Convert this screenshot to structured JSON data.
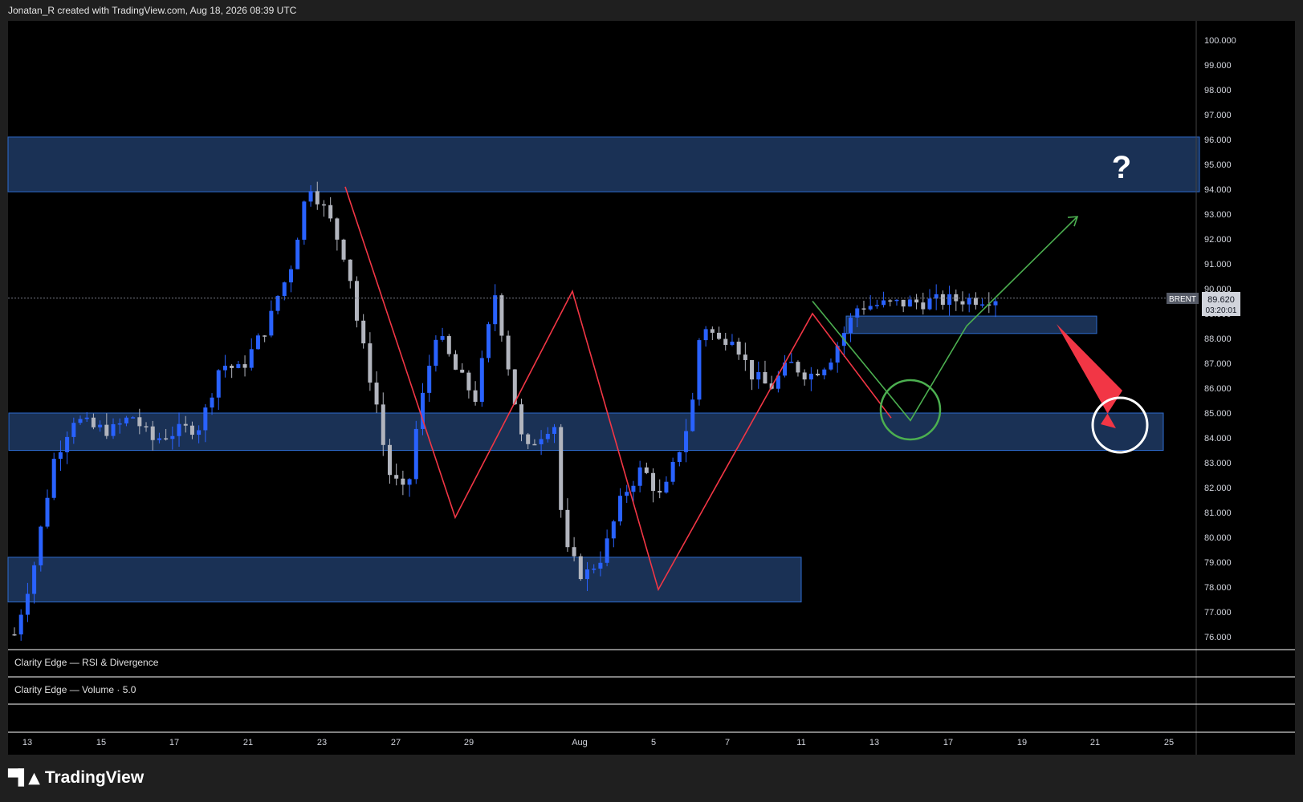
{
  "header": {
    "caption": "Jonatan_R created with TradingView.com, Aug 18, 2026 08:39 UTC"
  },
  "footer": {
    "brand": "TradingView",
    "brand_mark": "tradingview-logo-icon"
  },
  "colors": {
    "background": "#000000",
    "up_candle": "#2962ff",
    "down_candle": "#b2b5be",
    "zone_fill": "#1e3a64",
    "zone_border": "#2d6ccf",
    "red_path": "#f23645",
    "green_path": "#4caf50",
    "price_line": "#787b86",
    "panel_border": "#ffffff"
  },
  "panes": {
    "rsi_title": "Clarity Edge — RSI & Divergence",
    "volume_title": "Clarity Edge — Volume · 5.0"
  },
  "price_tag": {
    "symbol": "BRENT",
    "price": "89.620",
    "countdown": "03:20:01"
  },
  "annotations": {
    "question_mark": "?"
  },
  "chart_data": {
    "type": "candlestick",
    "symbol": "BRENT",
    "x_tick_labels": [
      "13",
      "15",
      "17",
      "21",
      "23",
      "27",
      "29",
      "Aug",
      "5",
      "7",
      "11",
      "13",
      "17",
      "19",
      "21",
      "25"
    ],
    "y_tick_labels": [
      "100.000",
      "99.000",
      "98.000",
      "97.000",
      "96.000",
      "95.000",
      "94.000",
      "93.000",
      "92.000",
      "91.000",
      "90.000",
      "89.000",
      "88.000",
      "87.000",
      "86.000",
      "85.000",
      "84.000",
      "83.000",
      "82.000",
      "81.000",
      "80.000",
      "79.000",
      "78.000",
      "77.000",
      "76.000"
    ],
    "ylim": [
      75.5,
      100.5
    ],
    "last_price": 89.62,
    "zones": [
      {
        "from": 93.9,
        "to": 96.1
      },
      {
        "from": 83.5,
        "to": 85.0
      },
      {
        "from": 77.4,
        "to": 79.2
      },
      {
        "from": 88.2,
        "to": 88.9
      }
    ],
    "zigzag_red": [
      94.1,
      80.8,
      89.9,
      77.9,
      89.0,
      84.8
    ],
    "path_green": [
      89.5,
      84.7,
      88.5,
      92.9
    ],
    "close_path": [
      76.1,
      78.9,
      83.1,
      84.8,
      84.4,
      84.3,
      84.9,
      83.9,
      84.2,
      84.5,
      87.0,
      86.7,
      88.7,
      89.9,
      90.6,
      94.3,
      92.9,
      91.0,
      88.5,
      85.2,
      82.7,
      81.6,
      84.5,
      88.3,
      86.7,
      85.6,
      89.8,
      83.3,
      83.9,
      84.7,
      79.6,
      78.4,
      79.3,
      81.7,
      82.8,
      81.5,
      85.0,
      88.7,
      87.8,
      88.3,
      86.6,
      86.0,
      87.0,
      86.5,
      87.1,
      89.3,
      89.65
    ],
    "close_path_samples": [
      0.0,
      0.02,
      0.04,
      0.06,
      0.08,
      0.1,
      0.12,
      0.14,
      0.16,
      0.19,
      0.21,
      0.23,
      0.26,
      0.27,
      0.28,
      0.3,
      0.32,
      0.34,
      0.35,
      0.37,
      0.38,
      0.4,
      0.41,
      0.43,
      0.45,
      0.47,
      0.49,
      0.52,
      0.53,
      0.55,
      0.56,
      0.58,
      0.6,
      0.62,
      0.64,
      0.66,
      0.69,
      0.7,
      0.72,
      0.73,
      0.75,
      0.77,
      0.79,
      0.81,
      0.83,
      0.86,
      1.0
    ]
  }
}
